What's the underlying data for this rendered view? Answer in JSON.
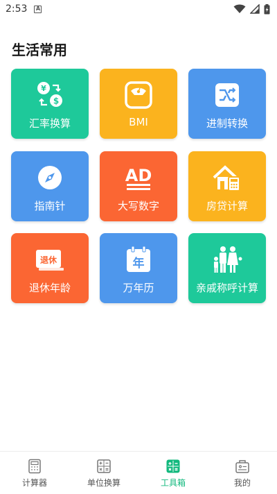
{
  "status": {
    "time": "2:53"
  },
  "section": {
    "title": "生活常用"
  },
  "tools": [
    {
      "label": "汇率换算",
      "color": "#1ec99a",
      "icon": "exchange-rate-icon"
    },
    {
      "label": "BMI",
      "color": "#fbb31e",
      "icon": "scale-icon"
    },
    {
      "label": "进制转换",
      "color": "#4e97ec",
      "icon": "base-convert-icon"
    },
    {
      "label": "指南针",
      "color": "#4e97ec",
      "icon": "compass-icon"
    },
    {
      "label": "大写数字",
      "color": "#fb6633",
      "icon": "uppercase-number-icon"
    },
    {
      "label": "房贷计算",
      "color": "#fbb31e",
      "icon": "house-loan-icon"
    },
    {
      "label": "退休年龄",
      "color": "#fb6633",
      "icon": "retire-icon"
    },
    {
      "label": "万年历",
      "color": "#4e97ec",
      "icon": "calendar-icon"
    },
    {
      "label": "亲戚称呼计算",
      "color": "#1ec99a",
      "icon": "family-icon"
    }
  ],
  "icon_text": {
    "retire": "退休",
    "calendar": "年",
    "ad": "AD"
  },
  "nav": [
    {
      "label": "计算器",
      "icon": "calculator-icon"
    },
    {
      "label": "单位换算",
      "icon": "unit-convert-icon"
    },
    {
      "label": "工具箱",
      "icon": "toolbox-icon",
      "active": true
    },
    {
      "label": "我的",
      "icon": "profile-icon"
    }
  ],
  "colors": {
    "accent": "#13b97e",
    "nav_inactive": "#555555"
  }
}
